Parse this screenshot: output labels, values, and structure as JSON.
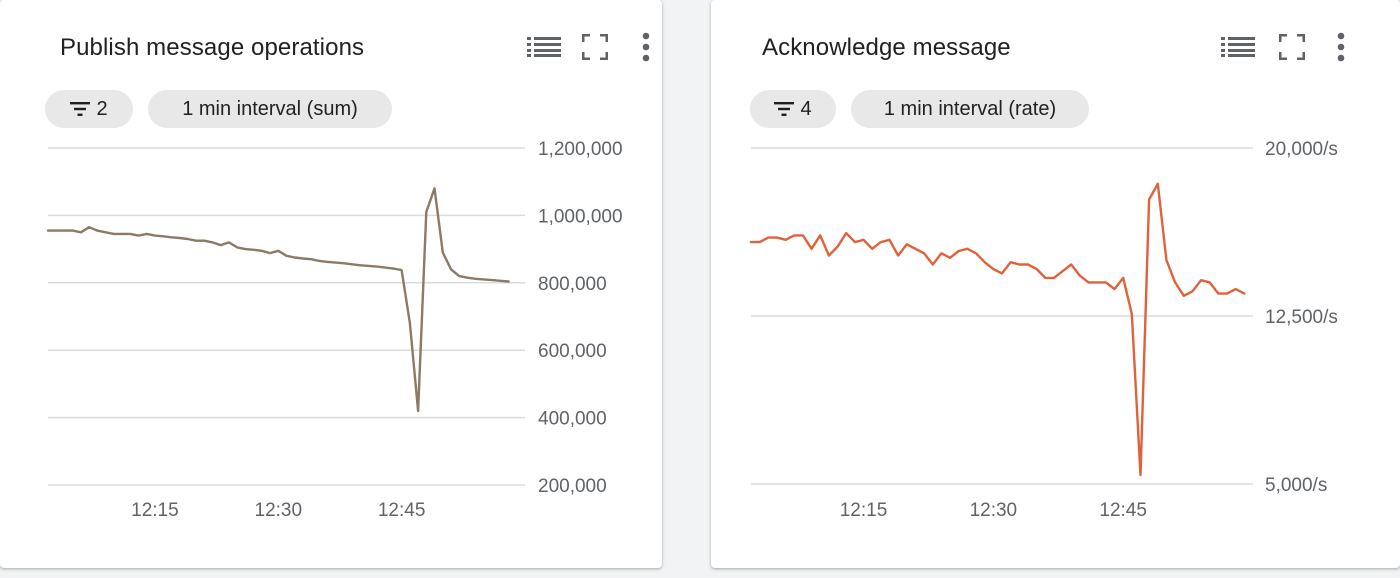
{
  "cards": [
    {
      "title": "Publish message operations",
      "toolbar": {
        "legend_icon": "legend-list-icon",
        "fullscreen_icon": "fullscreen-icon",
        "more_icon": "more-vert-icon"
      },
      "filter_chip": {
        "icon": "filter-icon",
        "count": "2"
      },
      "interval_chip": "1 min interval (sum)"
    },
    {
      "title": "Acknowledge message",
      "toolbar": {
        "legend_icon": "legend-list-icon",
        "fullscreen_icon": "fullscreen-icon",
        "more_icon": "more-vert-icon"
      },
      "filter_chip": {
        "icon": "filter-icon",
        "count": "4"
      },
      "interval_chip": "1 min interval (rate)"
    }
  ],
  "colors": {
    "series_0": "#8b7a64",
    "series_1": "#e1623a",
    "grid": "#dadce0",
    "tick_text": "#5f6368"
  },
  "chart_data": [
    {
      "type": "line",
      "title": "Publish message operations",
      "xlabel": "",
      "ylabel": "",
      "x_ticks": [
        "12:15",
        "12:30",
        "12:45"
      ],
      "x_tick_minutes": [
        15,
        30,
        45
      ],
      "xlim": [
        2,
        60
      ],
      "y_ticks": [
        "1,200,000",
        "1,000,000",
        "800,000",
        "600,000",
        "400,000",
        "200,000"
      ],
      "y_tick_values": [
        1200000,
        1000000,
        800000,
        600000,
        400000,
        200000
      ],
      "ylim": [
        200000,
        1200000
      ],
      "grid": true,
      "series": [
        {
          "x": [
            2,
            3,
            4,
            5,
            6,
            7,
            8,
            9,
            10,
            11,
            12,
            13,
            14,
            15,
            16,
            17,
            18,
            19,
            20,
            21,
            22,
            23,
            24,
            25,
            26,
            27,
            28,
            29,
            30,
            31,
            32,
            33,
            34,
            35,
            36,
            37,
            38,
            39,
            40,
            41,
            42,
            43,
            44,
            45,
            46,
            47,
            48,
            49,
            50,
            51,
            52,
            53,
            54,
            55,
            56,
            57,
            58
          ],
          "values": [
            955000,
            955000,
            955000,
            955000,
            950000,
            965000,
            955000,
            950000,
            945000,
            945000,
            945000,
            940000,
            945000,
            940000,
            938000,
            935000,
            933000,
            930000,
            925000,
            925000,
            920000,
            912000,
            920000,
            905000,
            900000,
            898000,
            895000,
            888000,
            895000,
            880000,
            875000,
            872000,
            870000,
            865000,
            862000,
            860000,
            858000,
            855000,
            852000,
            850000,
            848000,
            845000,
            842000,
            838000,
            680000,
            420000,
            1010000,
            1080000,
            890000,
            840000,
            820000,
            815000,
            812000,
            810000,
            808000,
            806000,
            804000
          ]
        }
      ]
    },
    {
      "type": "line",
      "title": "Acknowledge message",
      "xlabel": "",
      "ylabel": "",
      "x_ticks": [
        "12:15",
        "12:30",
        "12:45"
      ],
      "x_tick_minutes": [
        15,
        30,
        45
      ],
      "xlim": [
        2,
        60
      ],
      "y_ticks": [
        "20,000/s",
        "12,500/s",
        "5,000/s"
      ],
      "y_tick_values": [
        20000,
        12500,
        5000
      ],
      "ylim": [
        5000,
        20000
      ],
      "grid": true,
      "series": [
        {
          "x": [
            2,
            3,
            4,
            5,
            6,
            7,
            8,
            9,
            10,
            11,
            12,
            13,
            14,
            15,
            16,
            17,
            18,
            19,
            20,
            21,
            22,
            23,
            24,
            25,
            26,
            27,
            28,
            29,
            30,
            31,
            32,
            33,
            34,
            35,
            36,
            37,
            38,
            39,
            40,
            41,
            42,
            43,
            44,
            45,
            46,
            47,
            48,
            49,
            50,
            51,
            52,
            53,
            54,
            55,
            56,
            57,
            58,
            59
          ],
          "values": [
            15800,
            15800,
            16000,
            16000,
            15900,
            16100,
            16100,
            15500,
            16100,
            15200,
            15600,
            16200,
            15800,
            15900,
            15500,
            15800,
            15900,
            15200,
            15700,
            15500,
            15300,
            14800,
            15300,
            15100,
            15400,
            15500,
            15300,
            14900,
            14600,
            14400,
            14900,
            14800,
            14800,
            14600,
            14200,
            14200,
            14500,
            14800,
            14300,
            14000,
            14000,
            14000,
            13700,
            14200,
            12600,
            5400,
            17700,
            18400,
            15000,
            14000,
            13400,
            13600,
            14100,
            14000,
            13500,
            13500,
            13700,
            13500
          ]
        }
      ]
    }
  ]
}
